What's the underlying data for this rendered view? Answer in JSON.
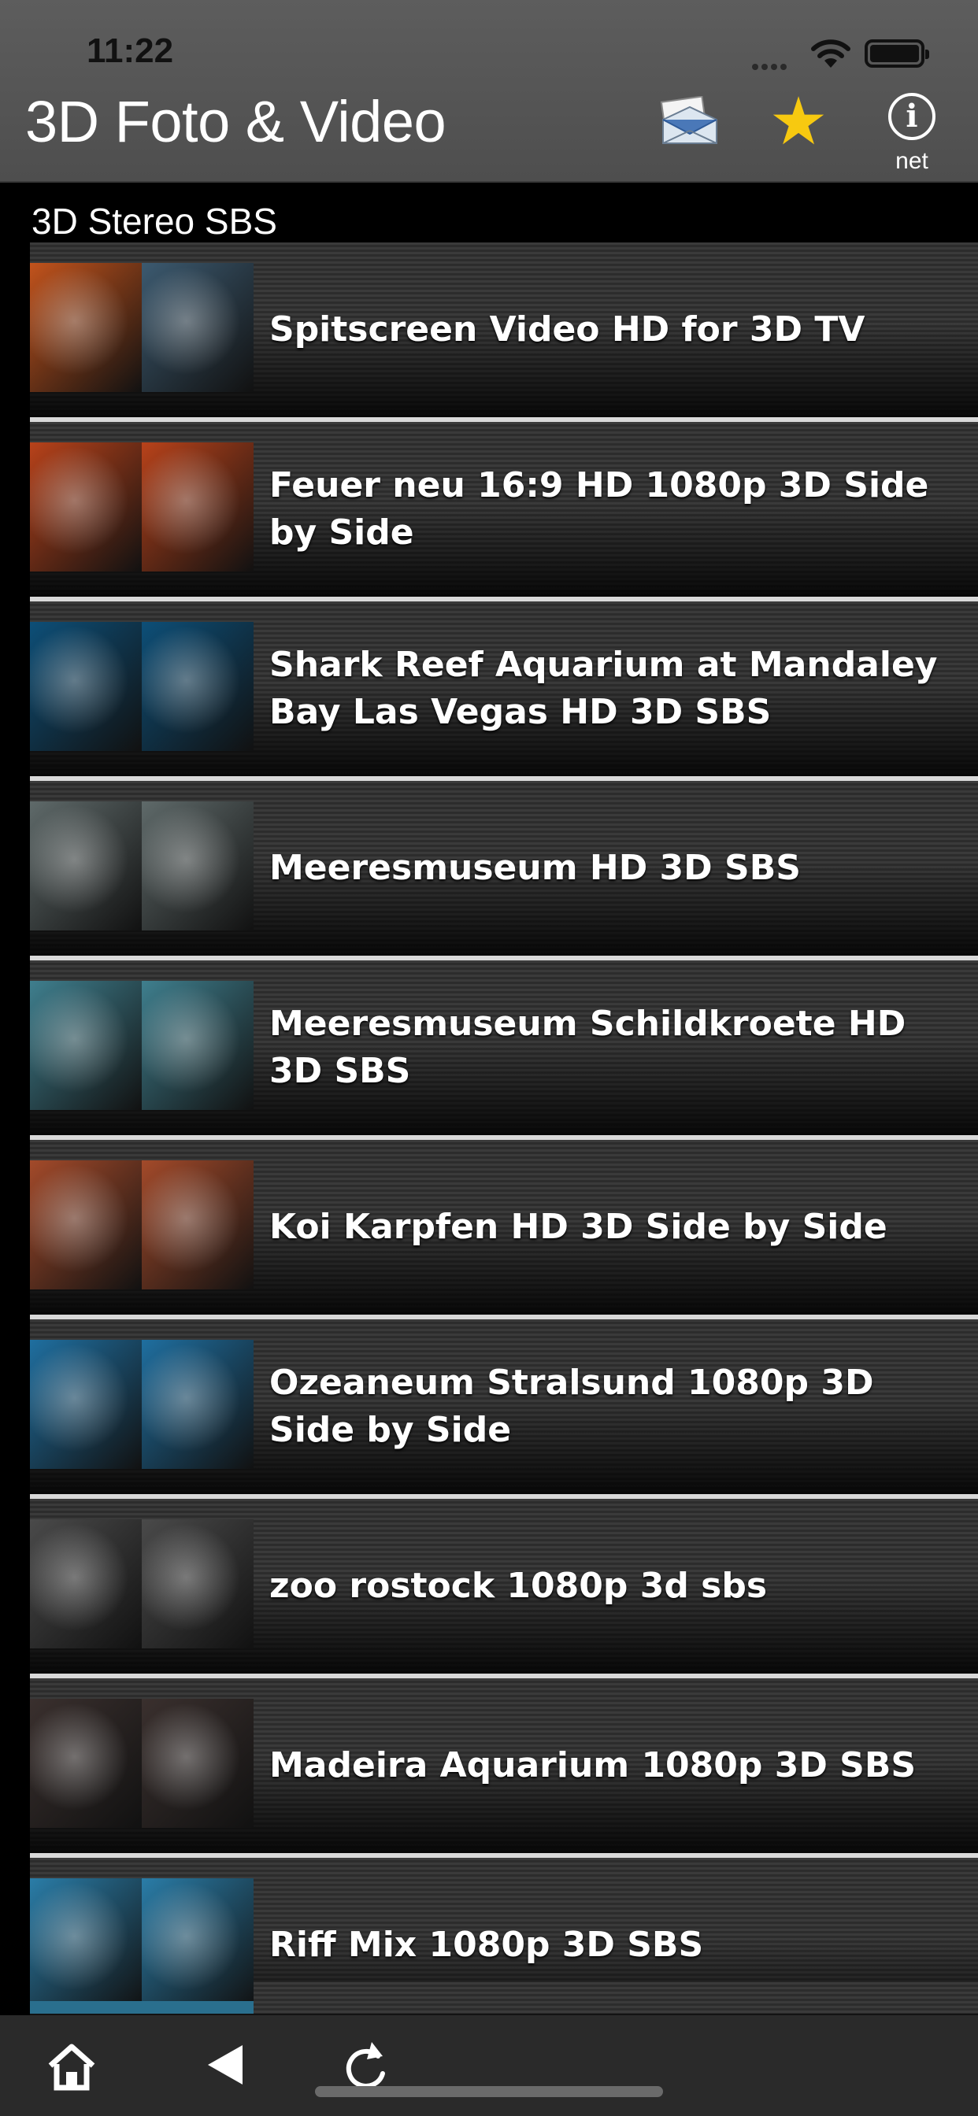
{
  "status_bar": {
    "time": "11:22"
  },
  "header": {
    "title": "3D Foto & Video",
    "info_label": "net",
    "star_color": "#f7c910"
  },
  "section": {
    "title": "3D Stereo SBS"
  },
  "videos": [
    {
      "title": "Spitscreen Video HD for 3D TV",
      "thumb": [
        "#c2531c",
        "#3c5a70"
      ]
    },
    {
      "title": "Feuer neu 16:9 HD 1080p 3D Side by Side",
      "thumb": [
        "#b8421a",
        "#b8421a"
      ]
    },
    {
      "title": "Shark Reef Aquarium at Mandaley Bay Las Vegas HD 3D SBS",
      "thumb": [
        "#0d4f78",
        "#0d4f78"
      ]
    },
    {
      "title": "Meeresmuseum HD 3D SBS",
      "thumb": [
        "#5f6a6a",
        "#5f6a6a"
      ]
    },
    {
      "title": "Meeresmuseum Schildkroete HD 3D SBS",
      "thumb": [
        "#3f7f8e",
        "#3f7f8e"
      ]
    },
    {
      "title": "Koi Karpfen HD 3D Side by Side",
      "thumb": [
        "#a34a2a",
        "#a34a2a"
      ]
    },
    {
      "title": "Ozeaneum Stralsund 1080p 3D Side by Side",
      "thumb": [
        "#1f6fa0",
        "#1f6fa0"
      ]
    },
    {
      "title": "zoo rostock 1080p 3d sbs",
      "thumb": [
        "#4a4a4a",
        "#4a4a4a"
      ]
    },
    {
      "title": "Madeira Aquarium 1080p 3D SBS",
      "thumb": [
        "#3a302e",
        "#3a302e"
      ]
    },
    {
      "title": "Riff Mix 1080p 3D SBS",
      "thumb": [
        "#2a7da8",
        "#2a7da8"
      ]
    }
  ]
}
